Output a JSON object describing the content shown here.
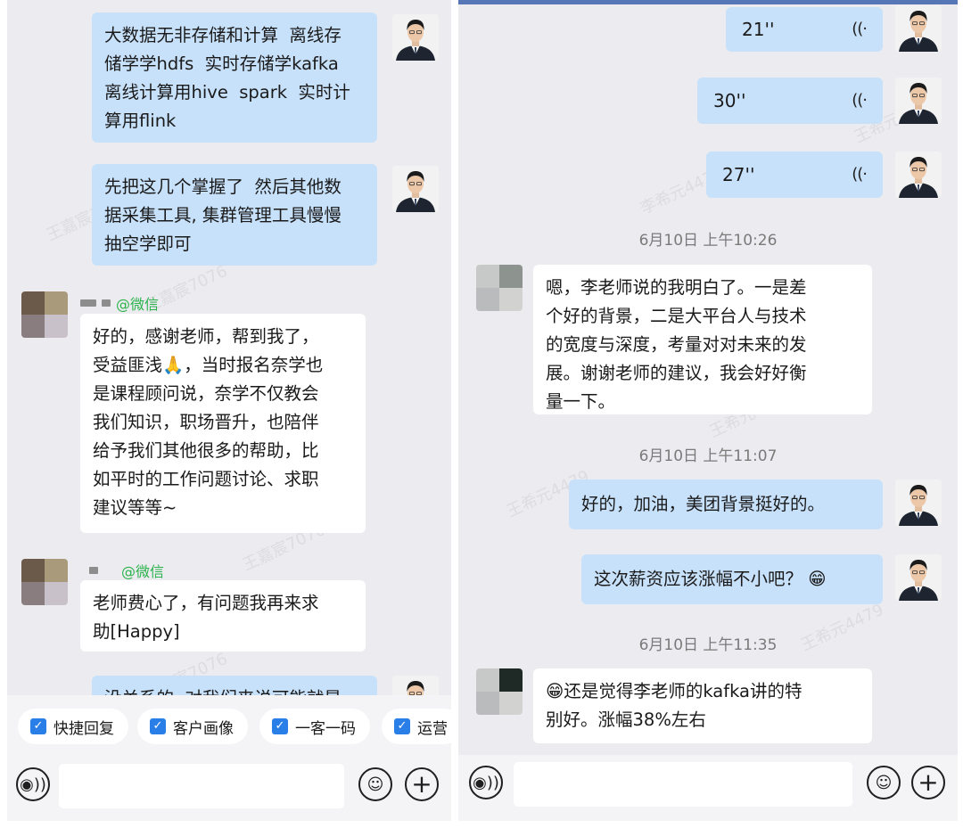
{
  "left": {
    "messages": [
      {
        "text": "大数据无非存储和计算  离线存\n储学学hdfs  实时存储学kafka\n离线计算用hive  spark  实时计\n算用flink"
      },
      {
        "text": "先把这几个掌握了  然后其他数\n据采集工具, 集群管理工具慢慢\n抽空学即可"
      },
      {
        "sender_tag": "微信",
        "text": "好的，感谢老师，帮到我了，\n受益匪浅🙏，当时报名奈学也\n是课程顾问说，奈学不仅教会\n我们知识，职场晋升，也陪伴\n给予我们其他很多的帮助，比\n如平时的工作问题讨论、求职\n建议等等~"
      },
      {
        "sender_tag": "微信",
        "text": "老师费心了，有问题我再来求\n助[Happy]"
      },
      {
        "text": "没关系的  对我们来说可能就是"
      }
    ],
    "shortcuts": [
      "快捷回复",
      "客户画像",
      "一客一码",
      "运营"
    ]
  },
  "right": {
    "voice_messages": [
      {
        "duration": "21''"
      },
      {
        "duration": "30''"
      },
      {
        "duration": "27''"
      }
    ],
    "timestamps": [
      "6月10日 上午10:26",
      "6月10日 上午11:07",
      "6月10日 上午11:35"
    ],
    "messages": [
      {
        "text": "嗯，李老师说的我明白了。一是差\n个好的背景，二是大平台人与技术\n的宽度与深度，考量对对未来的发\n展。谢谢老师的建议，我会好好衡\n量一下。"
      },
      {
        "text": "好的，加油，美团背景挺好的。"
      },
      {
        "text": "这次薪资应该涨幅不小吧？ 😁"
      },
      {
        "text": "😁还是觉得李老师的kafka讲的特\n别好。涨幅38%左右"
      }
    ]
  },
  "icons": {
    "voice_input": "voice-input-icon",
    "emoji": "emoji-icon",
    "add": "plus-icon",
    "checkbox": "checkbox-icon",
    "voice_wave": "voice-wave-icon"
  },
  "colors": {
    "bubble_self": "#c8e1fb",
    "bubble_other": "#ffffff",
    "background": "#ececf0",
    "wechat_tag": "#2bb24c",
    "checkbox": "#2a7ee8"
  }
}
